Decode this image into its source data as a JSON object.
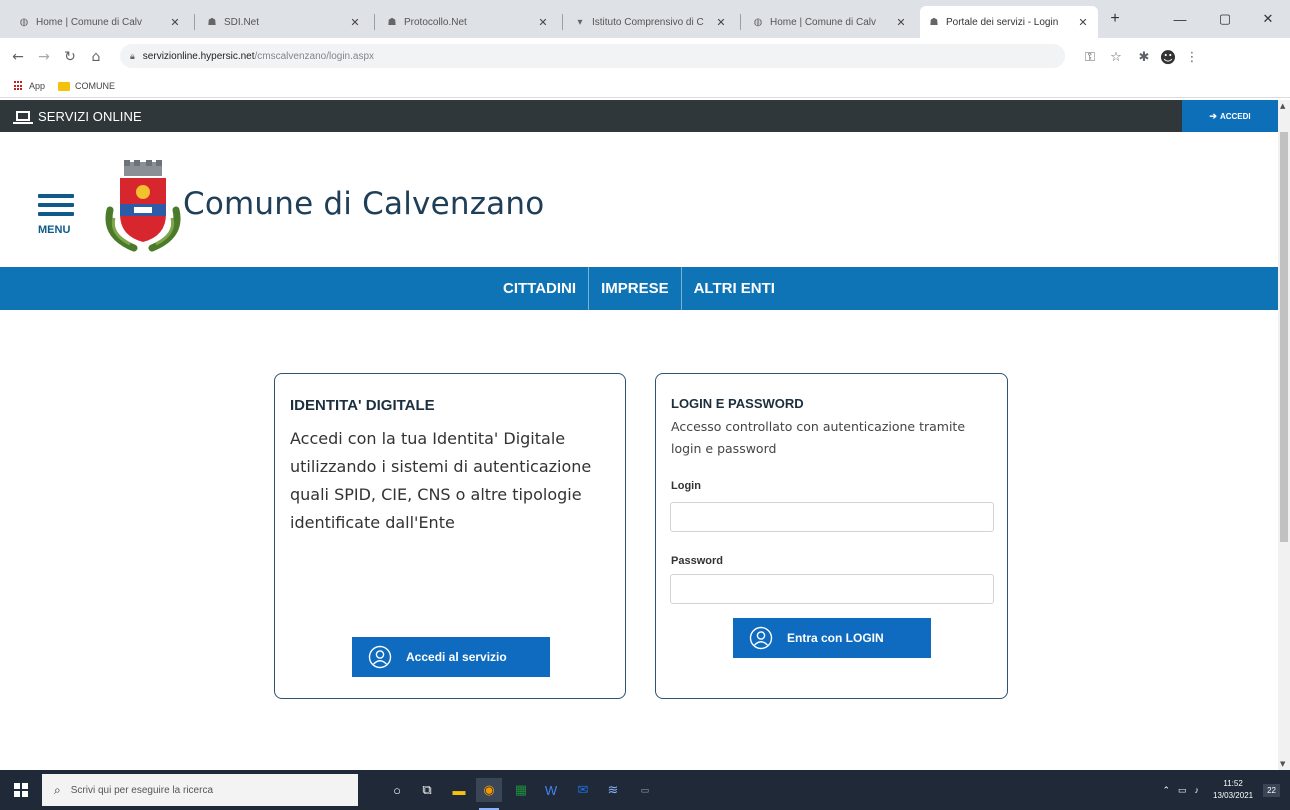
{
  "browser": {
    "tabs": [
      {
        "title": "Home | Comune di Calv",
        "icon": "globe-icon"
      },
      {
        "title": "SDI.Net",
        "icon": "app-icon"
      },
      {
        "title": "Protocollo.Net",
        "icon": "app-icon"
      },
      {
        "title": "Istituto Comprensivo di C",
        "icon": "school-icon"
      },
      {
        "title": "Home | Comune di Calv",
        "icon": "globe-icon"
      },
      {
        "title": "Portale dei servizi - Login",
        "icon": "app-icon",
        "active": true
      }
    ],
    "new_tab": "+",
    "window_controls": {
      "minimize": "—",
      "maximize": "▢",
      "close": "✕"
    },
    "url_host": "servizionline.hypersic.net",
    "url_path": "/cmscalvenzano/login.aspx",
    "bookmarks": [
      {
        "label": "App",
        "icon": "apps-grid-icon"
      },
      {
        "label": "COMUNE",
        "icon": "folder-icon"
      }
    ]
  },
  "topbar": {
    "brand": "SERVIZI ONLINE",
    "login_button": "ACCEDI"
  },
  "header": {
    "menu_label": "MENU",
    "site_title": "Comune di Calvenzano"
  },
  "nav": {
    "items": [
      "CITTADINI",
      "IMPRESE",
      "ALTRI ENTI"
    ]
  },
  "spid_card": {
    "title": "IDENTITA' DIGITALE",
    "description": "Accedi con la tua Identita' Digitale utilizzando i sistemi di autenticazione quali SPID, CIE, CNS o altre tipologie identificate dall'Ente",
    "button": "Accedi al servizio"
  },
  "login_card": {
    "title": "LOGIN E PASSWORD",
    "description": "Accesso controllato con autenticazione tramite login e password",
    "login_label": "Login",
    "login_value": "",
    "password_label": "Password",
    "password_value": "",
    "button": "Entra con LOGIN"
  },
  "taskbar": {
    "search_placeholder": "Scrivi qui per eseguire la ricerca",
    "time": "11:52",
    "date": "13/03/2021",
    "notifications_badge": "22"
  },
  "colors": {
    "topbar": "#30373b",
    "nav": "#0e74b6",
    "button": "#0e6bbf",
    "title": "#1e3f57"
  }
}
